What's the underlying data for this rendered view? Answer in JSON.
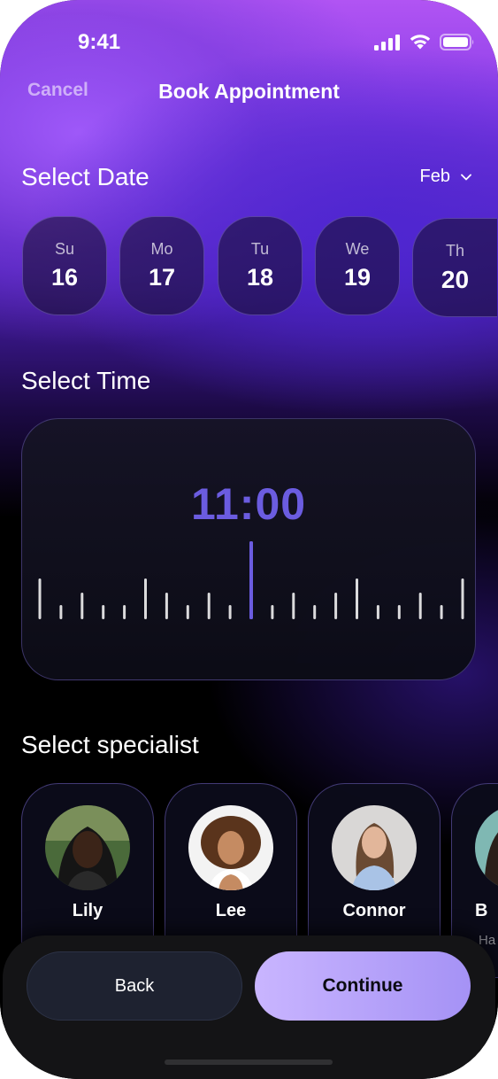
{
  "status_bar": {
    "time": "9:41",
    "icons": [
      "cellular-signal-icon",
      "wifi-icon",
      "battery-icon"
    ]
  },
  "nav": {
    "cancel": "Cancel",
    "title": "Book Appointment"
  },
  "date_section": {
    "title": "Select Date",
    "month": "Feb",
    "days": [
      {
        "name": "Su",
        "num": "16"
      },
      {
        "name": "Mo",
        "num": "17"
      },
      {
        "name": "Tu",
        "num": "18"
      },
      {
        "name": "We",
        "num": "19"
      },
      {
        "name": "Th",
        "num": "20"
      }
    ]
  },
  "time_section": {
    "title": "Select Time",
    "value": "11:00"
  },
  "specialist_section": {
    "title": "Select specialist",
    "specialists": [
      {
        "name": "Lily",
        "sub": ""
      },
      {
        "name": "Lee",
        "sub": ""
      },
      {
        "name": "Connor",
        "sub": ""
      },
      {
        "name": "B",
        "sub": "Ha"
      }
    ]
  },
  "actions": {
    "back": "Back",
    "continue": "Continue"
  },
  "colors": {
    "accent": "#6b5ce0",
    "continue_button": "#b8a6fb",
    "background": "#000000"
  }
}
